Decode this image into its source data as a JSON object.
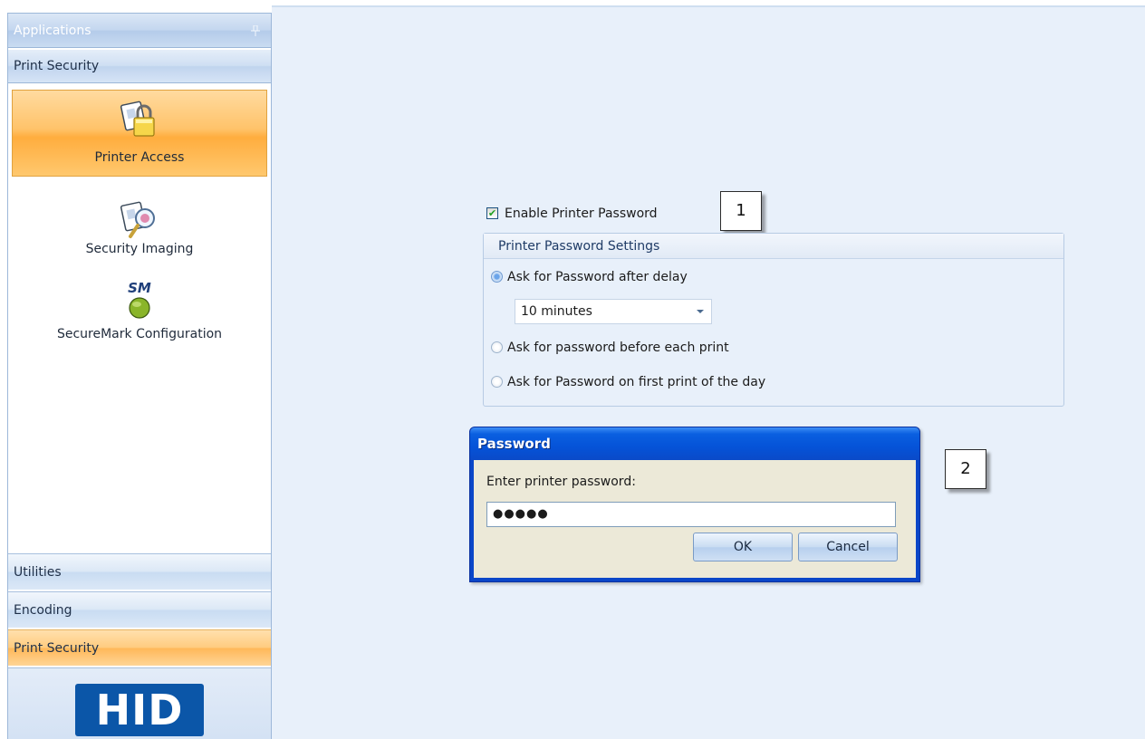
{
  "sidebar": {
    "header": "Applications",
    "pin_glyph": "ᵖ",
    "group_title": "Print Security",
    "items": [
      {
        "label": "Printer Access",
        "icon": "printer-access-icon",
        "selected": true
      },
      {
        "label": "Security Imaging",
        "icon": "security-imaging-icon"
      },
      {
        "label": "SecureMark Configuration",
        "icon": "securemark-icon",
        "icon_text": "SM"
      }
    ],
    "nav": [
      {
        "label": "Utilities"
      },
      {
        "label": "Encoding"
      },
      {
        "label": "Print Security",
        "active": true
      }
    ],
    "logo_text": "HID"
  },
  "main": {
    "enable_checkbox": {
      "label": "Enable Printer Password",
      "checked": true
    },
    "settings_group": {
      "title": "Printer Password Settings",
      "options": [
        {
          "label": "Ask for Password after delay",
          "checked": true
        },
        {
          "label": "Ask for password before each print",
          "checked": false
        },
        {
          "label": "Ask for Password on first print of the day",
          "checked": false
        }
      ],
      "delay_value": "10 minutes"
    },
    "callouts": [
      "1",
      "2"
    ]
  },
  "dialog": {
    "title": "Password",
    "prompt": "Enter printer password:",
    "password_mask": "●●●●●",
    "ok_label": "OK",
    "cancel_label": "Cancel"
  },
  "colors": {
    "selected_orange": "#ffc36a",
    "dialog_titlebar": "#0553d8",
    "main_bg": "#e8f0fa",
    "hid_blue": "#0b56a8"
  }
}
